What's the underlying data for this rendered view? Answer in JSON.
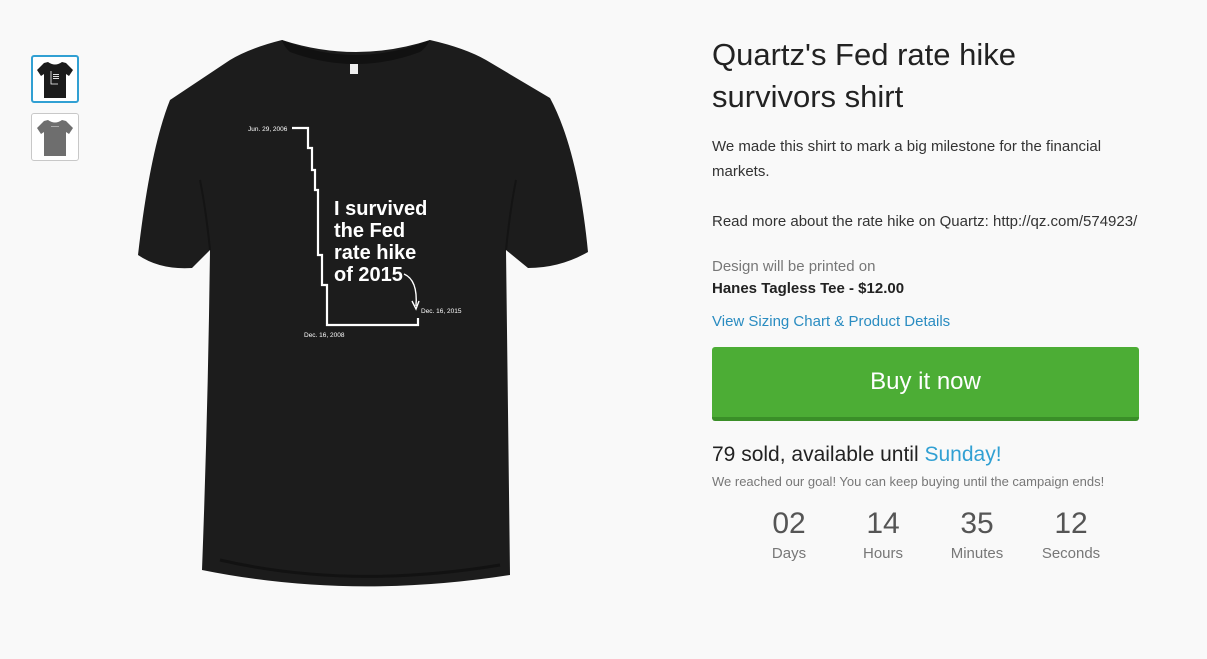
{
  "product": {
    "title": "Quartz's Fed rate hike survivors shirt",
    "description": "We made this shirt to mark a big milestone for the financial markets.",
    "read_more": "Read more about the rate hike on Quartz: http://qz.com/574923/",
    "printed_on_label": "Design will be printed on",
    "printed_on_product": "Hanes Tagless Tee - $12.00",
    "sizing_link": "View Sizing Chart & Product Details",
    "buy_button": "Buy it now"
  },
  "campaign": {
    "sold_text": "79 sold, available until ",
    "until_day": "Sunday!",
    "goal_note": "We reached our goal! You can keep buying until the campaign ends!"
  },
  "countdown": [
    {
      "value": "02",
      "label": "Days"
    },
    {
      "value": "14",
      "label": "Hours"
    },
    {
      "value": "35",
      "label": "Minutes"
    },
    {
      "value": "12",
      "label": "Seconds"
    }
  ],
  "shirt_art": {
    "headline_lines": [
      "I survived",
      "the Fed",
      "rate hike",
      "of 2015"
    ],
    "date_start": "Jun. 29, 2006",
    "date_low": "Dec. 16, 2008",
    "date_end": "Dec. 16, 2015"
  },
  "thumbnails": [
    {
      "name": "black-shirt",
      "color": "#1b1b1b"
    },
    {
      "name": "gray-shirt",
      "color": "#6e6e6e"
    }
  ],
  "colors": {
    "accent_blue": "#31a0d3",
    "buy_green": "#4cad35",
    "shirt_black": "#1b1b1b"
  }
}
